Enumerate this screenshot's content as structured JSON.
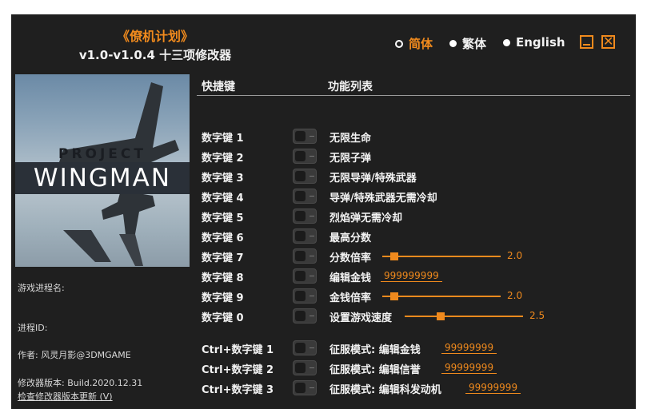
{
  "header": {
    "game_title": "《僚机计划》",
    "version_title": "v1.0-v1.0.4 十三项修改器"
  },
  "languages": [
    {
      "label": "简体",
      "selected": true
    },
    {
      "label": "繁体",
      "selected": false
    },
    {
      "label": "English",
      "selected": false
    }
  ],
  "cover": {
    "logo_line1": "PROJECT",
    "logo_line2": "WINGMAN"
  },
  "info": {
    "process_name": "游戏进程名:",
    "process_id": "进程ID:",
    "author": "作者: 风灵月影@3DMGAME",
    "build": "修改器版本: Build.2020.12.31",
    "update_link": "检查修改器版本更新 (V)"
  },
  "columns": {
    "hotkey": "快捷键",
    "features": "功能列表"
  },
  "rows": [
    {
      "key": "数字键 1",
      "label": "无限生命"
    },
    {
      "key": "数字键 2",
      "label": "无限子弹"
    },
    {
      "key": "数字键 3",
      "label": "无限导弹/特殊武器"
    },
    {
      "key": "数字键 4",
      "label": "导弹/特殊武器无需冷却"
    },
    {
      "key": "数字键 5",
      "label": "烈焰弹无需冷却"
    },
    {
      "key": "数字键 6",
      "label": "最高分数"
    },
    {
      "key": "数字键 7",
      "label": "分数倍率",
      "slider_value": "2.0",
      "slider_fraction": 0.07
    },
    {
      "key": "数字键 8",
      "label": "编辑金钱",
      "edit_value": "999999999"
    },
    {
      "key": "数字键 9",
      "label": "金钱倍率",
      "slider_value": "2.0",
      "slider_fraction": 0.07
    },
    {
      "key": "数字键 0",
      "label": "设置游戏速度",
      "slider_value": "2.5",
      "slider_fraction": 0.27
    },
    {
      "key": "Ctrl+数字键 1",
      "label": "征服模式: 编辑金钱",
      "edit_value": "99999999"
    },
    {
      "key": "Ctrl+数字键 2",
      "label": "征服模式: 编辑信誉",
      "edit_value": "99999999"
    },
    {
      "key": "Ctrl+数字键 3",
      "label": "征服模式: 编辑科发动机",
      "edit_value": "99999999"
    }
  ],
  "colors": {
    "accent": "#f08a1d",
    "background": "#1f1f1f"
  }
}
